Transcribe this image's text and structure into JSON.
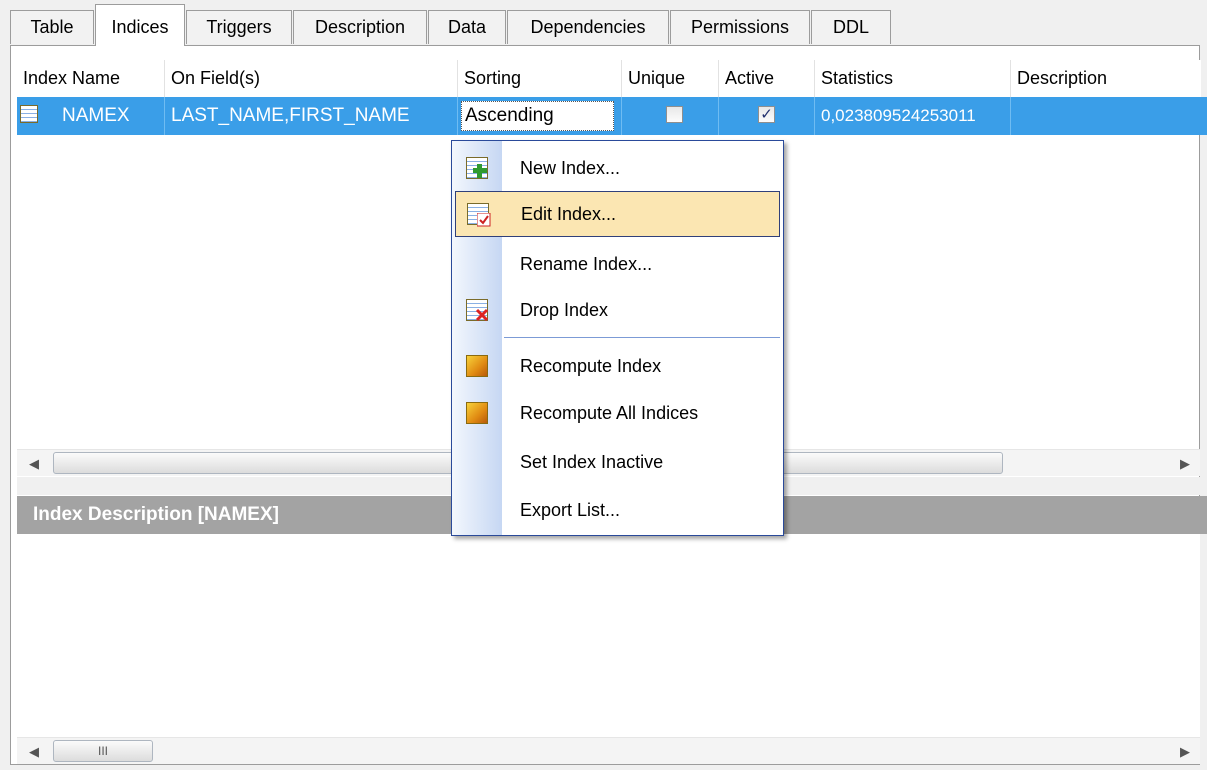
{
  "tabs": [
    {
      "label": "Table"
    },
    {
      "label": "Indices"
    },
    {
      "label": "Triggers"
    },
    {
      "label": "Description"
    },
    {
      "label": "Data"
    },
    {
      "label": "Dependencies"
    },
    {
      "label": "Permissions"
    },
    {
      "label": "DDL"
    }
  ],
  "grid": {
    "headers": [
      "Index Name",
      "On Field(s)",
      "Sorting",
      "Unique",
      "Active",
      "Statistics",
      "Description"
    ],
    "row": {
      "index_name": "NAMEX",
      "fields": "LAST_NAME,FIRST_NAME",
      "sorting": "Ascending",
      "unique": false,
      "active": true,
      "statistics": "0,023809524253011",
      "description": ""
    }
  },
  "description_panel": {
    "title": "Index Description [NAMEX]"
  },
  "scroll": {
    "bottom_thumb_grip": "III"
  },
  "context_menu": {
    "items": [
      {
        "label": "New Index...",
        "icon": "new-index-icon"
      },
      {
        "label": "Edit Index...",
        "icon": "edit-index-icon",
        "highlighted": true
      },
      {
        "label": "Rename Index...",
        "icon": ""
      },
      {
        "label": "Drop Index",
        "icon": "drop-index-icon"
      },
      {
        "label": "Recompute Index",
        "icon": "recompute-index-icon"
      },
      {
        "label": "Recompute All Indices",
        "icon": "recompute-all-icon"
      },
      {
        "label": "Set Index Inactive",
        "icon": ""
      },
      {
        "label": "Export List...",
        "icon": ""
      }
    ]
  },
  "colors": {
    "selection": "#3a9ee8",
    "menu_highlight": "#fbe6b2",
    "panel_header": "#a3a3a3"
  }
}
